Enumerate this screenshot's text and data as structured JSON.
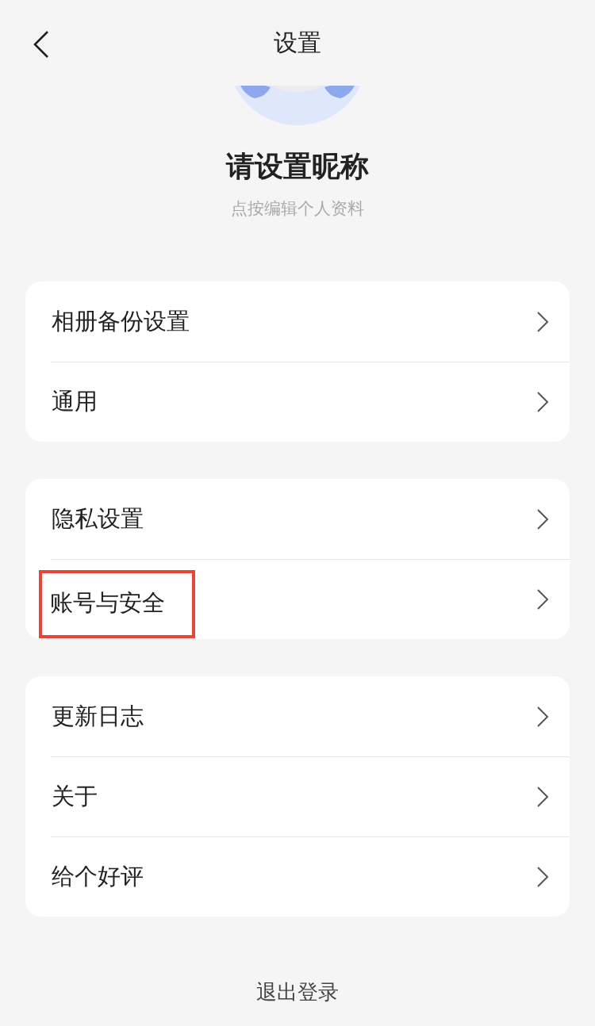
{
  "header": {
    "title": "设置"
  },
  "profile": {
    "nickname": "请设置昵称",
    "hint": "点按编辑个人资料"
  },
  "groups": [
    {
      "items": [
        {
          "label": "相册备份设置",
          "highlighted": false
        },
        {
          "label": "通用",
          "highlighted": false
        }
      ]
    },
    {
      "items": [
        {
          "label": "隐私设置",
          "highlighted": false
        },
        {
          "label": "账号与安全",
          "highlighted": true
        }
      ]
    },
    {
      "items": [
        {
          "label": "更新日志",
          "highlighted": false
        },
        {
          "label": "关于",
          "highlighted": false
        },
        {
          "label": "给个好评",
          "highlighted": false
        }
      ]
    }
  ],
  "logout": "退出登录"
}
